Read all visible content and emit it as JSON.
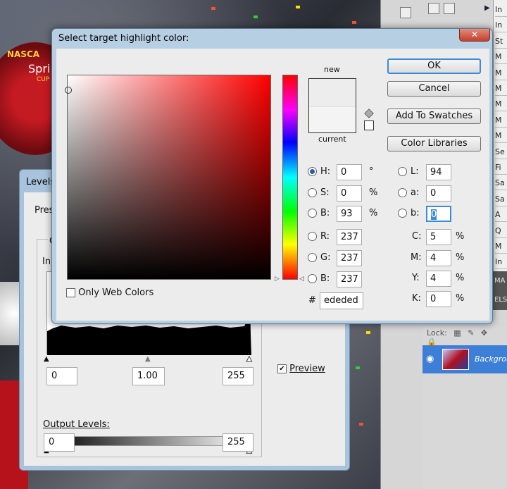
{
  "colors": {
    "accent": "#3b8bd6",
    "dialog_frame": "#b7cfe3",
    "dialog_body": "#ececec",
    "new_color": "#ededed",
    "current_color": "#f4f4f4",
    "layer_selected": "#3d7fd6"
  },
  "color_picker": {
    "title": "Select target highlight color:",
    "close_icon": "close-icon",
    "new_label": "new",
    "current_label": "current",
    "only_web_colors_label": "Only Web Colors",
    "only_web_colors_checked": false,
    "buttons": {
      "ok": "OK",
      "cancel": "Cancel",
      "add_to_swatches": "Add To Swatches",
      "color_libraries": "Color Libraries"
    },
    "hsb": [
      {
        "key": "H",
        "label": "H:",
        "value": "0",
        "unit": "°",
        "selected": true
      },
      {
        "key": "S",
        "label": "S:",
        "value": "0",
        "unit": "%",
        "selected": false
      },
      {
        "key": "B",
        "label": "B:",
        "value": "93",
        "unit": "%",
        "selected": false
      }
    ],
    "rgb": [
      {
        "key": "R",
        "label": "R:",
        "value": "237"
      },
      {
        "key": "G",
        "label": "G:",
        "value": "237"
      },
      {
        "key": "B",
        "label": "B:",
        "value": "237"
      }
    ],
    "lab": [
      {
        "key": "L",
        "label": "L:",
        "value": "94"
      },
      {
        "key": "a",
        "label": "a:",
        "value": "0"
      },
      {
        "key": "b",
        "label": "b:",
        "value": "0"
      }
    ],
    "cmyk": [
      {
        "key": "C",
        "label": "C:",
        "value": "5",
        "unit": "%"
      },
      {
        "key": "M",
        "label": "M:",
        "value": "4",
        "unit": "%"
      },
      {
        "key": "Y",
        "label": "Y:",
        "value": "4",
        "unit": "%"
      },
      {
        "key": "K",
        "label": "K:",
        "value": "0",
        "unit": "%"
      }
    ],
    "hex_label": "#",
    "hex_value": "ededed"
  },
  "levels": {
    "title": "Levels",
    "preset_label": "Pres",
    "channel_label": "C",
    "input_label": "In",
    "input_values": [
      "0",
      "1.00",
      "255"
    ],
    "output_label": "Output Levels:",
    "output_values": [
      "0",
      "255"
    ],
    "preview_label": "Preview",
    "preview_checked": true
  },
  "photo_text": {
    "brand": "NASCA",
    "brand2": "Spri",
    "brand3": "CUP"
  },
  "history_items": [
    "In",
    "In",
    "St",
    "M",
    "M",
    "M",
    "M",
    "M",
    "M",
    "Se",
    "Fi",
    "Sa",
    "Sa",
    "A",
    "Q",
    "M",
    "In"
  ],
  "layers": {
    "lock_label": "Lock:",
    "layer_name": "Background",
    "visibility_icon": "eye-icon"
  },
  "panel_tabs": [
    "MA",
    "ELS"
  ]
}
